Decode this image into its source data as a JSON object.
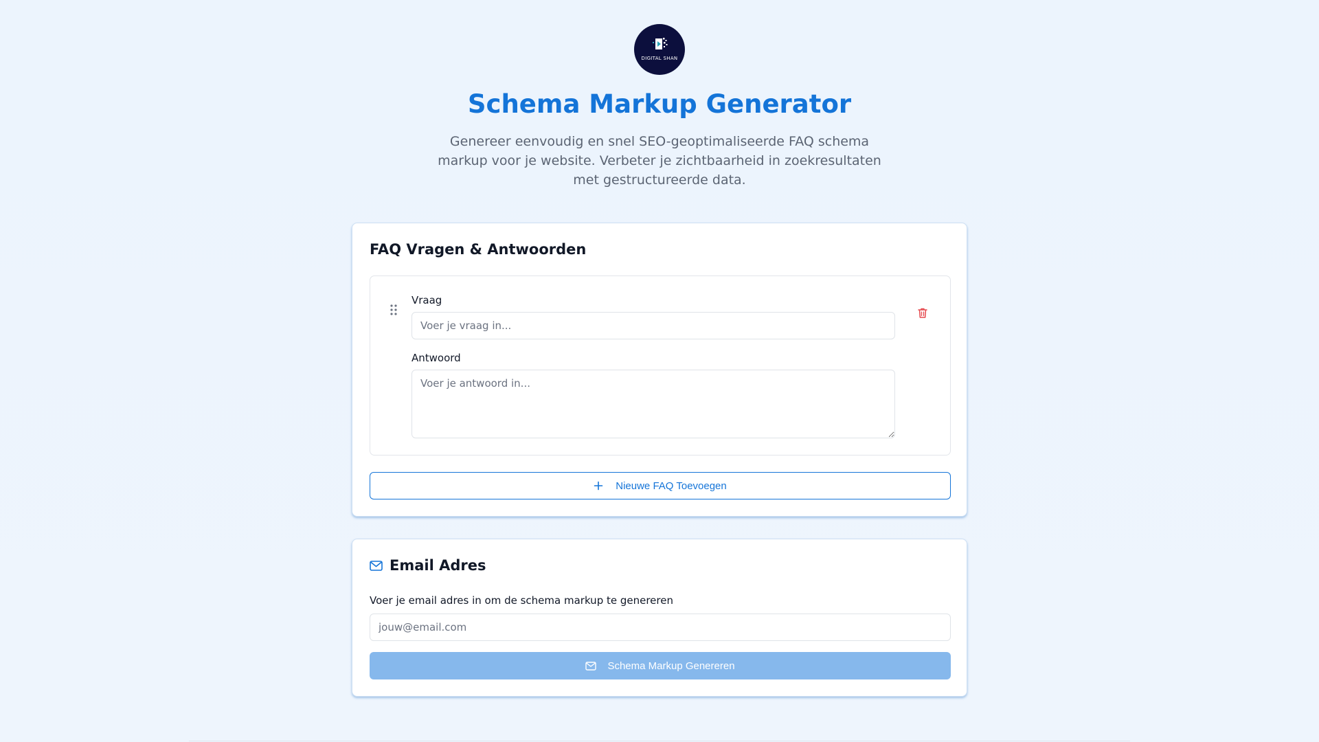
{
  "header": {
    "logo_text": "DIGITAL SHAN",
    "title": "Schema Markup Generator",
    "subtitle": "Genereer eenvoudig en snel SEO-geoptimaliseerde FAQ schema markup voor je website. Verbeter je zichtbaarheid in zoekresultaten met gestructureerde data."
  },
  "faq_section": {
    "title": "FAQ Vragen & Antwoorden",
    "items": [
      {
        "question_label": "Vraag",
        "question_placeholder": "Voer je vraag in...",
        "question_value": "",
        "answer_label": "Antwoord",
        "answer_placeholder": "Voer je antwoord in...",
        "answer_value": ""
      }
    ],
    "add_button_label": "Nieuwe FAQ Toevoegen"
  },
  "email_section": {
    "title": "Email Adres",
    "description": "Voer je email adres in om de schema markup te genereren",
    "email_placeholder": "jouw@email.com",
    "email_value": "",
    "generate_button_label": "Schema Markup Genereren"
  },
  "colors": {
    "primary": "#1474d8",
    "button_disabled": "#86b8ec",
    "delete": "#e5484d",
    "logo_bg": "#0c0f3d"
  },
  "icons": {
    "logo": "digital-shan-logo",
    "drag": "grip-vertical-icon",
    "delete": "trash-icon",
    "add": "plus-icon",
    "mail": "mail-icon"
  }
}
